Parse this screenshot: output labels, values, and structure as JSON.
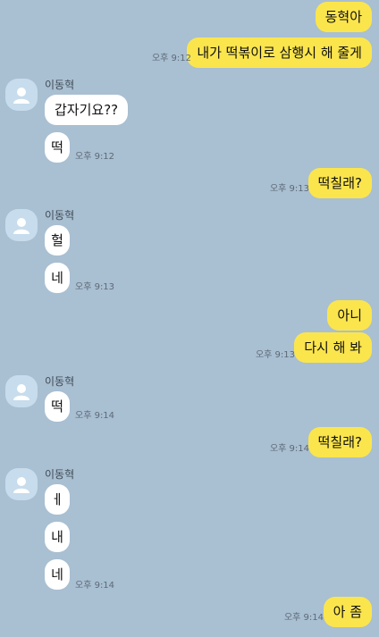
{
  "chat": {
    "sender_name": "이동혁",
    "messages": [
      {
        "from": "me",
        "text": "동혁아"
      },
      {
        "from": "me",
        "text": "내가 떡볶이로 삼행시 해 줄게",
        "time": "오후 9:12"
      },
      {
        "from": "other",
        "text": "갑자기요??"
      },
      {
        "from": "other",
        "text": "떡",
        "time": "오후 9:12"
      },
      {
        "from": "me",
        "text": "떡칠래?",
        "time": "오후 9:13"
      },
      {
        "from": "other",
        "text": "헐"
      },
      {
        "from": "other",
        "text": "네",
        "time": "오후 9:13"
      },
      {
        "from": "me",
        "text": "아니"
      },
      {
        "from": "me",
        "text": "다시 해 봐",
        "time": "오후 9:13"
      },
      {
        "from": "other",
        "text": "떡",
        "time": "오후 9:14"
      },
      {
        "from": "me",
        "text": "떡칠래?",
        "time": "오후 9:14"
      },
      {
        "from": "other",
        "text": "ㅔ"
      },
      {
        "from": "other",
        "text": "내"
      },
      {
        "from": "other",
        "text": "네",
        "time": "오후 9:14"
      },
      {
        "from": "me",
        "text": "아 좀",
        "time": "오후 9:14"
      }
    ]
  },
  "colors": {
    "background": "#a9bfd2",
    "my_bubble": "#fbe54d",
    "their_bubble": "#ffffff"
  },
  "icons": {
    "avatar": "default-profile-icon"
  }
}
